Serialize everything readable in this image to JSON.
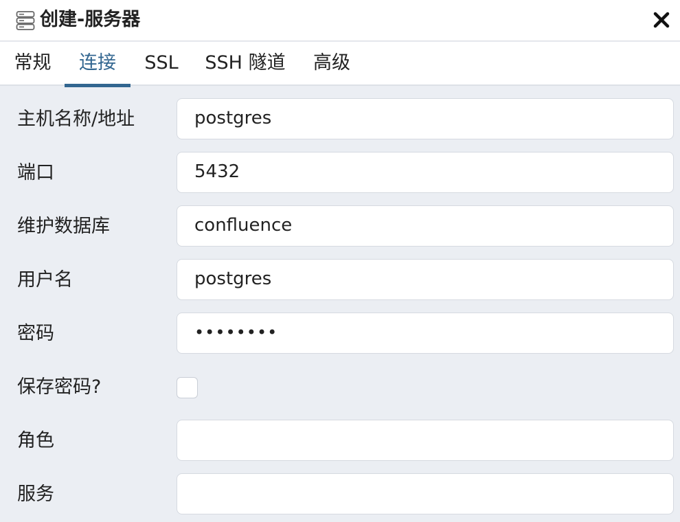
{
  "dialog": {
    "title": "创建-服务器",
    "title_icon": "server-icon",
    "close_icon": "close-icon"
  },
  "tabs": [
    {
      "label": "常规",
      "active": false
    },
    {
      "label": "连接",
      "active": true
    },
    {
      "label": "SSL",
      "active": false
    },
    {
      "label": "SSH 隧道",
      "active": false
    },
    {
      "label": "高级",
      "active": false
    }
  ],
  "form": {
    "host": {
      "label": "主机名称/地址",
      "value": "postgres"
    },
    "port": {
      "label": "端口",
      "value": "5432"
    },
    "maintenance_db": {
      "label": "维护数据库",
      "value": "confluence"
    },
    "username": {
      "label": "用户名",
      "value": "postgres"
    },
    "password": {
      "label": "密码",
      "value": "••••••••"
    },
    "save_password": {
      "label": "保存密码?",
      "checked": false
    },
    "role": {
      "label": "角色",
      "value": ""
    },
    "service": {
      "label": "服务",
      "value": ""
    }
  },
  "colors": {
    "accent": "#326690",
    "panel_bg": "#ebeef3",
    "header_bg": "#ffffff"
  }
}
